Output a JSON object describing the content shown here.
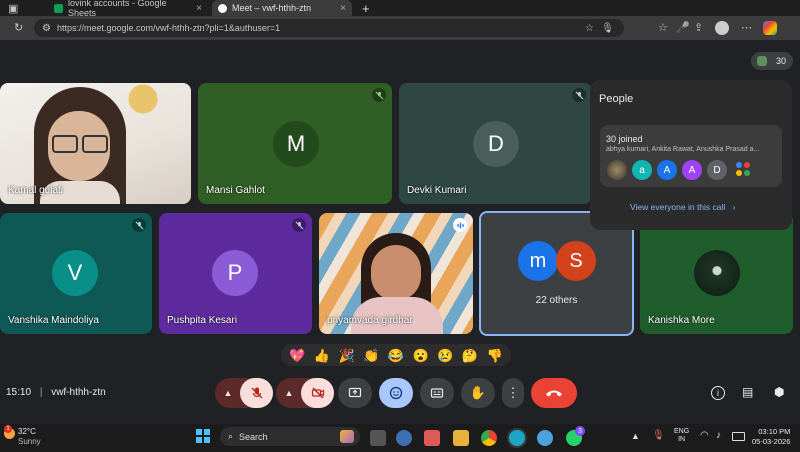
{
  "browser": {
    "tabs": [
      {
        "label": "lovink accounts - Google Sheets",
        "icon": "sheets-icon"
      },
      {
        "label": "Meet – vwf-hthh-ztn",
        "icon": "meet-icon"
      }
    ],
    "url": "https://meet.google.com/vwf-hthh-ztn?pli=1&authuser=1"
  },
  "meeting": {
    "participant_count_badge": "30",
    "tiles": [
      {
        "name": "Kamal gulati",
        "type": "video"
      },
      {
        "name": "Mansi Gahlot",
        "initial": "M",
        "muted": true
      },
      {
        "name": "Devki Kumari",
        "initial": "D",
        "muted": true
      },
      {
        "name": "Vanshika Maindoliya",
        "initial": "V",
        "muted": true
      },
      {
        "name": "Pushpita Kesari",
        "initial": "P",
        "muted": true
      },
      {
        "name": "priyamvada girdhar",
        "type": "video"
      },
      {
        "name": "22 others",
        "initials": [
          "m",
          "S"
        ]
      },
      {
        "name": "Kanishka More",
        "type": "photo"
      }
    ],
    "people_panel": {
      "title": "People",
      "joined": "30 joined",
      "names": "abhya kumari, Ankita Rawat, Anushka Prasad a...",
      "avatars": [
        "a",
        "A",
        "A",
        "D"
      ],
      "view_all": "View everyone in this call"
    },
    "reactions": [
      "💖",
      "👍",
      "🎉",
      "👏",
      "😂",
      "😮",
      "😢",
      "🤔",
      "👎"
    ],
    "time": "15:10",
    "code": "vwf-hthh-ztn"
  },
  "taskbar": {
    "weather_temp": "32°C",
    "weather_desc": "Sunny",
    "weather_badge": "1",
    "search_label": "Search",
    "whatsapp_badge": "3",
    "lang": "ENG",
    "lang_region": "IN",
    "clock_time": "03:10 PM",
    "clock_date": "05-03-2026"
  },
  "colors": {
    "meet_bg": "#202124",
    "end_call": "#ea4335",
    "mute_red": "#8c1d18",
    "accent_blue": "#8ab4f8"
  }
}
